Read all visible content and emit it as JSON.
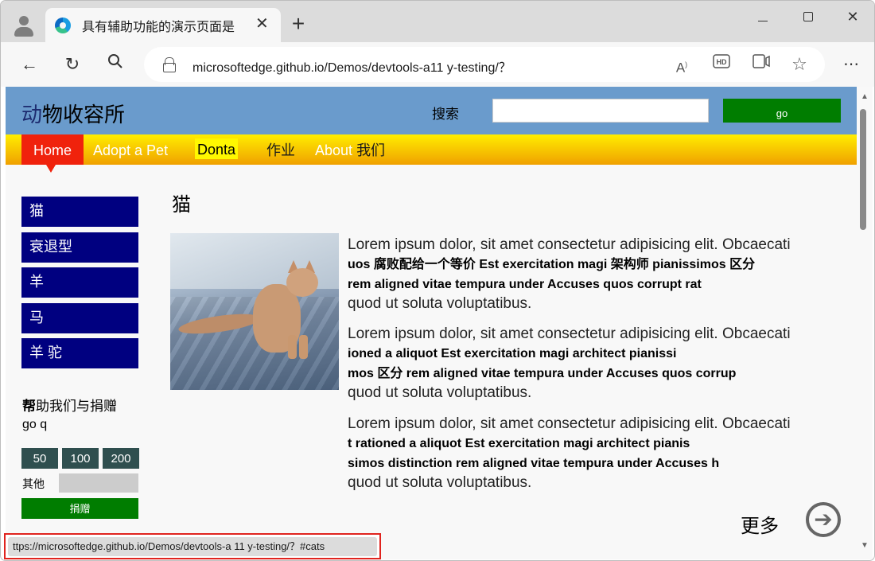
{
  "browser": {
    "tab_title": "具有辅助功能的演示页面是",
    "tab_close_glyph": "✕",
    "new_tab_glyph": "+",
    "url": "microsoftedge.github.io/Demos/devtools-a11 y-testing/？",
    "status_url": "ttps://microsoftedge.github.io/Demos/devtools-a 11 y-testing/？#cats",
    "icons": [
      "back-icon",
      "refresh-icon",
      "search-icon",
      "read-aloud-icon",
      "hd-icon",
      "immersive-reader-icon",
      "favorite-star-icon",
      "more-icon"
    ]
  },
  "site": {
    "title_light": "动",
    "title_rest": "物收容所",
    "search_label": "搜索",
    "search_value": "",
    "go_label": "go",
    "nav": {
      "home": "Home",
      "adopt": "Adopt a Pet",
      "donate": "Donta",
      "jobs": "作业",
      "about_en": "About",
      "about_cn": "我们"
    },
    "sidebar": [
      "猫",
      "衰退型",
      "羊",
      "马",
      "羊 驼"
    ],
    "donate": {
      "title_bold": "帮",
      "title_rest": "助我们与捐赠",
      "subtitle": "go q",
      "amounts": [
        "50",
        "100",
        "200"
      ],
      "other_label": "其他",
      "submit_label": "捐赠"
    }
  },
  "main": {
    "heading": "猫",
    "paragraphs": [
      {
        "l1": "Lorem ipsum dolor, sit amet consectetur adipisicing elit. Obcaecati",
        "l2": "uos 腐败配给一个等价 Est exercitation magi 架构师 pianissimos 区分",
        "l3": "rem aligned vitae tempura under Accuses quos corrupt rat",
        "l4": "quod ut soluta voluptatibus."
      },
      {
        "l1": "Lorem ipsum dolor, sit amet consectetur adipisicing elit. Obcaecati",
        "l2": "ioned a aliquot Est exercitation magi architect pianissi",
        "l3": "mos 区分 rem aligned vitae tempura under Accuses quos corrup",
        "l4": "quod ut soluta voluptatibus."
      },
      {
        "l1": "Lorem ipsum dolor, sit amet consectetur adipisicing elit. Obcaecati",
        "l2": "t rationed a aliquot Est exercitation magi architect pianis",
        "l3": "simos distinction rem aligned vitae tempura under Accuses h",
        "l4": "quod ut soluta voluptatibus."
      }
    ],
    "more_label": "更多",
    "more_icon": "➔"
  },
  "colors": {
    "header_bg": "#6a9bcc",
    "nav_home_bg": "#f0220c",
    "sidebar_bg": "#000080",
    "go_bg": "#007d00",
    "amount_bg": "#2f4f4f",
    "status_highlight": "#e0231e"
  }
}
